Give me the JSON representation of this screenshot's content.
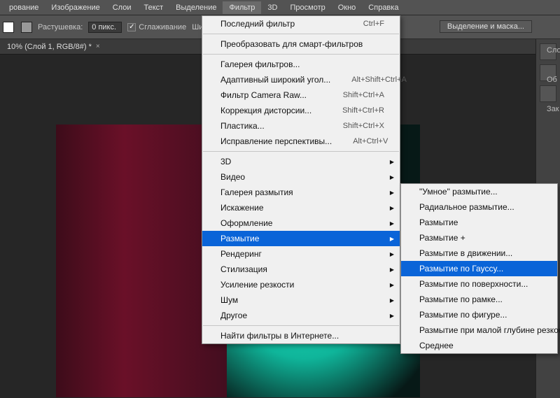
{
  "menubar": {
    "items": [
      "рование",
      "Изображение",
      "Слои",
      "Текст",
      "Выделение",
      "Фильтр",
      "3D",
      "Просмотр",
      "Окно",
      "Справка"
    ],
    "active_index": 5
  },
  "options_bar": {
    "feather_label": "Растушевка:",
    "feather_value": "0 пикс.",
    "antialias_label": "Сглаживание",
    "antialias_checked": true,
    "width_label": "Ширина",
    "select_mask_btn": "Выделение и маска..."
  },
  "document_tab": {
    "title": "10% (Слой 1, RGB/8#) *"
  },
  "filter_menu": {
    "last_filter": "Последний фильтр",
    "last_filter_shortcut": "Ctrl+F",
    "convert_smart": "Преобразовать для смарт-фильтров",
    "gallery": "Галерея фильтров...",
    "adaptive_wide": "Адаптивный широкий угол...",
    "adaptive_wide_shortcut": "Alt+Shift+Ctrl+A",
    "camera_raw": "Фильтр Camera Raw...",
    "camera_raw_shortcut": "Shift+Ctrl+A",
    "lens_correction": "Коррекция дисторсии...",
    "lens_correction_shortcut": "Shift+Ctrl+R",
    "liquify": "Пластика...",
    "liquify_shortcut": "Shift+Ctrl+X",
    "vanishing_point": "Исправление перспективы...",
    "vanishing_point_shortcut": "Alt+Ctrl+V",
    "sub_3d": "3D",
    "sub_video": "Видео",
    "sub_blur_gallery": "Галерея размытия",
    "sub_distort": "Искажение",
    "sub_stylize_group": "Оформление",
    "sub_blur": "Размытие",
    "sub_render": "Рендеринг",
    "sub_stylize": "Стилизация",
    "sub_sharpen": "Усиление резкости",
    "sub_noise": "Шум",
    "sub_other": "Другое",
    "find_online": "Найти фильтры в Интернете..."
  },
  "blur_submenu": {
    "smart_blur": "\"Умное\" размытие...",
    "radial_blur": "Радиальное размытие...",
    "blur": "Размытие",
    "blur_more": "Размытие +",
    "motion_blur": "Размытие в движении...",
    "gaussian_blur": "Размытие по Гауссу...",
    "surface_blur": "Размытие по поверхности...",
    "box_blur": "Размытие по рамке...",
    "shape_blur": "Размытие по фигуре...",
    "lens_blur": "Размытие при малой глубине резкости...",
    "average": "Среднее"
  },
  "side_panel": {
    "labels": [
      "Сло",
      "Об",
      "Зак"
    ]
  }
}
